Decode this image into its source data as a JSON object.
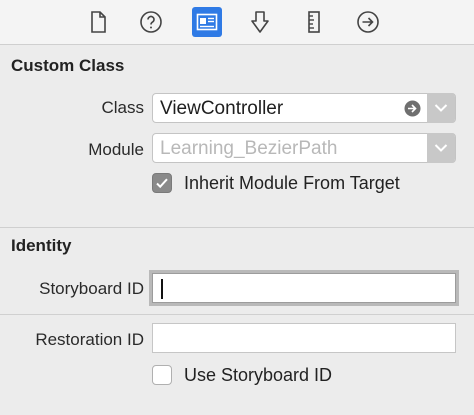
{
  "toolbar": {
    "icons": [
      {
        "name": "file-inspector-icon"
      },
      {
        "name": "quick-help-icon"
      },
      {
        "name": "identity-inspector-icon",
        "active": true
      },
      {
        "name": "attributes-inspector-icon"
      },
      {
        "name": "size-inspector-icon"
      },
      {
        "name": "connections-inspector-icon"
      }
    ],
    "active_color": "#2f7ae5"
  },
  "custom_class": {
    "title": "Custom Class",
    "class_label": "Class",
    "class_value": "ViewController",
    "module_label": "Module",
    "module_placeholder": "Learning_BezierPath",
    "inherit_label": "Inherit Module From Target",
    "inherit_checked": true
  },
  "identity": {
    "title": "Identity",
    "storyboard_id_label": "Storyboard ID",
    "storyboard_id_value": "",
    "restoration_id_label": "Restoration ID",
    "restoration_id_value": "",
    "use_storyboard_label": "Use Storyboard ID",
    "use_storyboard_checked": false
  }
}
